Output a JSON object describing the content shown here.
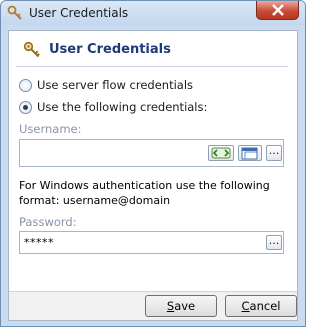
{
  "window": {
    "title": "User Credentials"
  },
  "header": {
    "title": "User Credentials"
  },
  "options": [
    {
      "label": "Use server flow credentials",
      "checked": false
    },
    {
      "label": "Use the following credentials:",
      "checked": true
    }
  ],
  "username": {
    "label": "Username:",
    "value": ""
  },
  "note": {
    "text": "For Windows authentication use the following format: username@domain"
  },
  "password": {
    "label": "Password:",
    "value": "*****"
  },
  "buttons": {
    "save": {
      "mnemonic": "S",
      "rest": "ave"
    },
    "cancel": {
      "mnemonic": "C",
      "rest": "ancel"
    },
    "browse_label": "...",
    "expression_icon": "expression-icon",
    "window_icon": "window-icon"
  },
  "colors": {
    "title_accent": "#1e3a78",
    "label_gray": "#8a93a8",
    "close_red": "#c94d37"
  }
}
